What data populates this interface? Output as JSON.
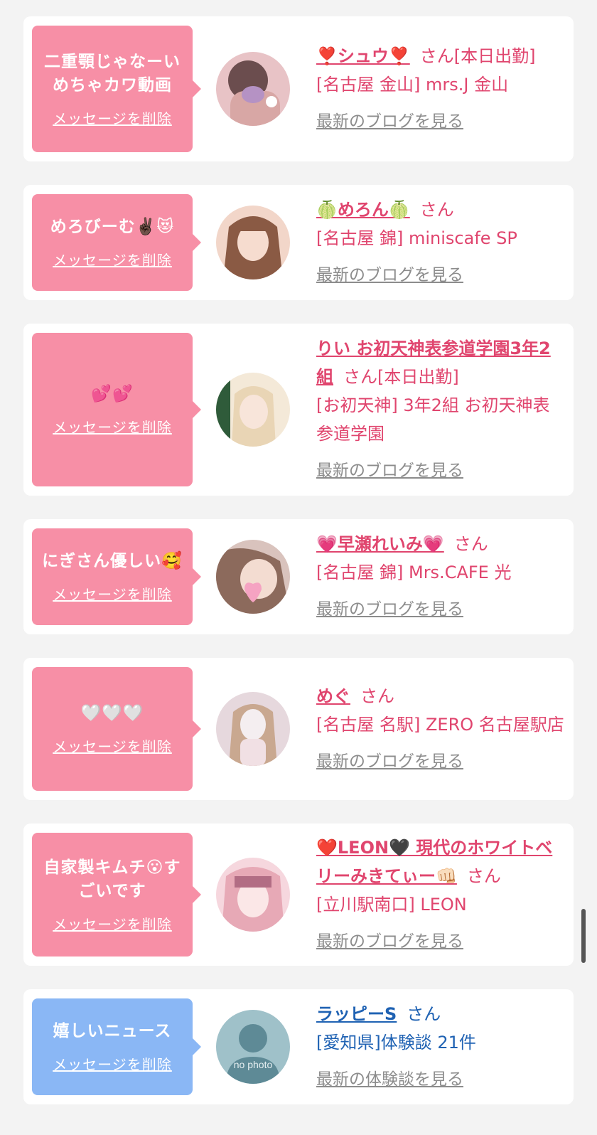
{
  "cards": [
    {
      "message": "二重顎じゃなーい\nめちゃカワ動画",
      "delete_label": "メッセージを削除",
      "name": "❣️シュウ❣️",
      "suffix": "さん[本日出勤]",
      "shop": "[名古屋 金山] mrs.J 金山",
      "blog_label": "最新のブログを見る",
      "bubble_color": "#f78fa6",
      "avatar_colors": [
        "#e8c3c6",
        "#6b4d4e",
        "#b592c4"
      ]
    },
    {
      "message": "めろびーむ✌🏿😻",
      "delete_label": "メッセージを削除",
      "name": "🍈めろん🍈",
      "suffix": "さん",
      "shop": "[名古屋 錦] miniscafe SP",
      "blog_label": "最新のブログを見る",
      "bubble_color": "#f78fa6",
      "avatar_colors": [
        "#d59a86",
        "#8a5a44",
        "#f2d6c9"
      ]
    },
    {
      "message": "💕💕",
      "delete_label": "メッセージを削除",
      "name": "りい お初天神表参道学園3年2組",
      "suffix": "さん[本日出勤]",
      "shop": "[お初天神] 3年2組 お初天神表参道学園",
      "blog_label": "最新のブログを見る",
      "bubble_color": "#f78fa6",
      "avatar_colors": [
        "#e9d5b5",
        "#2f5b3a",
        "#f4e9d8"
      ]
    },
    {
      "message": "にぎさん優しい🥰",
      "delete_label": "メッセージを削除",
      "name": "💗早瀬れいみ💗",
      "suffix": "さん",
      "shop": "[名古屋 錦] Mrs.CAFE 光",
      "blog_label": "最新のブログを見る",
      "bubble_color": "#f78fa6",
      "avatar_colors": [
        "#d9c3bd",
        "#8c6a5c",
        "#f5a3c2"
      ]
    },
    {
      "message": "🤍🤍🤍",
      "delete_label": "メッセージを削除",
      "name": "めぐ",
      "suffix": "さん",
      "shop": "[名古屋 名駅] ZERO 名古屋駅店",
      "blog_label": "最新のブログを見る",
      "bubble_color": "#f78fa6",
      "avatar_colors": [
        "#e6d8dd",
        "#c9a890",
        "#f4eef0"
      ]
    },
    {
      "message": "自家製キムチ😮すごいです",
      "delete_label": "メッセージを削除",
      "name": "❤️LEON🖤 現代のホワイトベリーみきてぃー👊🏻",
      "suffix": "さん",
      "shop": "[立川駅南口] LEON",
      "blog_label": "最新のブログを見る",
      "bubble_color": "#f78fa6",
      "avatar_colors": [
        "#e7a9b6",
        "#b26d84",
        "#f6d7de"
      ]
    },
    {
      "message": "嬉しいニュース",
      "delete_label": "メッセージを削除",
      "name": "ラッピーS",
      "suffix": "さん",
      "shop": "[愛知県]体験談 21件",
      "blog_label": "最新の体験談を見る",
      "bubble_color": "#8ab7f5",
      "avatar_colors": [
        "#9fc1c9",
        "#5e8a96",
        "#c9dde1"
      ],
      "avatar_text": "no photo"
    }
  ]
}
